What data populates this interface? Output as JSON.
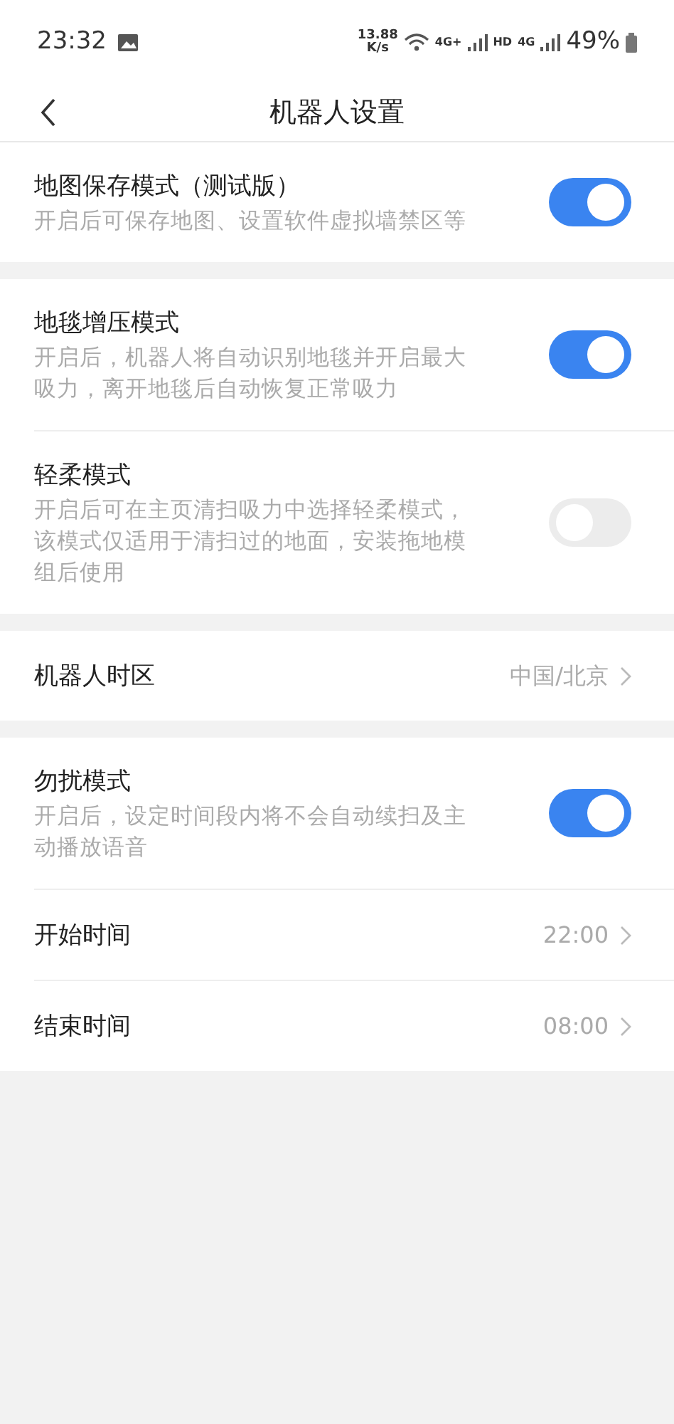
{
  "status_bar": {
    "time": "23:32",
    "speed_value": "13.88",
    "speed_unit": "K/s",
    "network_1": "4G+",
    "hd": "HD",
    "network_2": "4G",
    "battery": "49%"
  },
  "header": {
    "title": "机器人设置"
  },
  "groups": [
    {
      "rows": [
        {
          "kind": "toggle",
          "title": "地图保存模式（测试版）",
          "description": "开启后可保存地图、设置软件虚拟墙禁区等",
          "on": true
        }
      ]
    },
    {
      "rows": [
        {
          "kind": "toggle",
          "title": "地毯增压模式",
          "description": "开启后，机器人将自动识别地毯并开启最大吸力，离开地毯后自动恢复正常吸力",
          "on": true
        },
        {
          "kind": "toggle",
          "title": "轻柔模式",
          "description": "开启后可在主页清扫吸力中选择轻柔模式，该模式仅适用于清扫过的地面，安装拖地模组后使用",
          "on": false
        }
      ]
    },
    {
      "rows": [
        {
          "kind": "link",
          "title": "机器人时区",
          "value": "中国/北京"
        }
      ]
    },
    {
      "rows": [
        {
          "kind": "toggle",
          "title": "勿扰模式",
          "description": "开启后，设定时间段内将不会自动续扫及主动播放语音",
          "on": true
        },
        {
          "kind": "link",
          "title": "开始时间",
          "value": "22:00"
        },
        {
          "kind": "link",
          "title": "结束时间",
          "value": "08:00"
        }
      ]
    }
  ]
}
